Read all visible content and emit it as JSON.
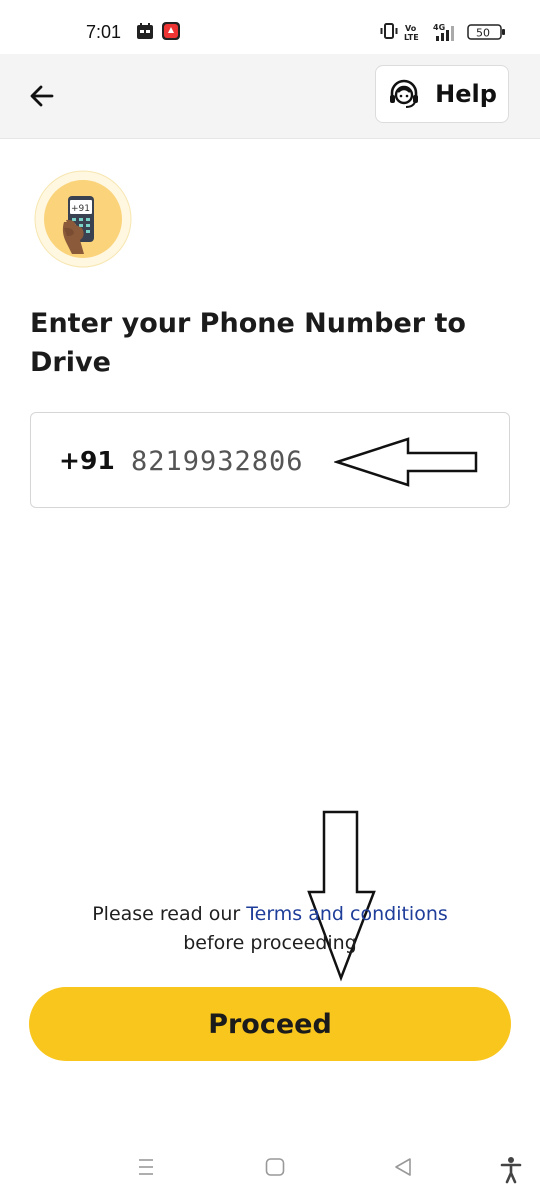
{
  "status_bar": {
    "time": "7:01",
    "icons": [
      "calendar-icon",
      "notification-icon",
      "vibrate-icon",
      "volte-icon",
      "signal-4g-icon",
      "battery-icon"
    ],
    "volte_label": "Vo LTE",
    "network_label": "4G",
    "battery_level": "50"
  },
  "header": {
    "back_icon": "arrow-left-icon",
    "help_label": "Help",
    "help_icon": "support-agent-icon"
  },
  "hero": {
    "icon": "hand-holding-phone-icon",
    "badge_text": "+91"
  },
  "main": {
    "title": "Enter your Phone Number to Drive",
    "country_code": "+91",
    "phone_number": "8219932806"
  },
  "terms": {
    "prefix": "Please read our ",
    "link": "Terms and conditions",
    "suffix": "before proceeding"
  },
  "proceed": {
    "label": "Proceed"
  },
  "nav_bar": {
    "icons": [
      "recent-apps-icon",
      "home-icon",
      "back-triangle-icon",
      "accessibility-icon"
    ]
  },
  "colors": {
    "accent": "#f9c61e",
    "link": "#1f3e9a",
    "header_bg": "#f4f4f4"
  }
}
